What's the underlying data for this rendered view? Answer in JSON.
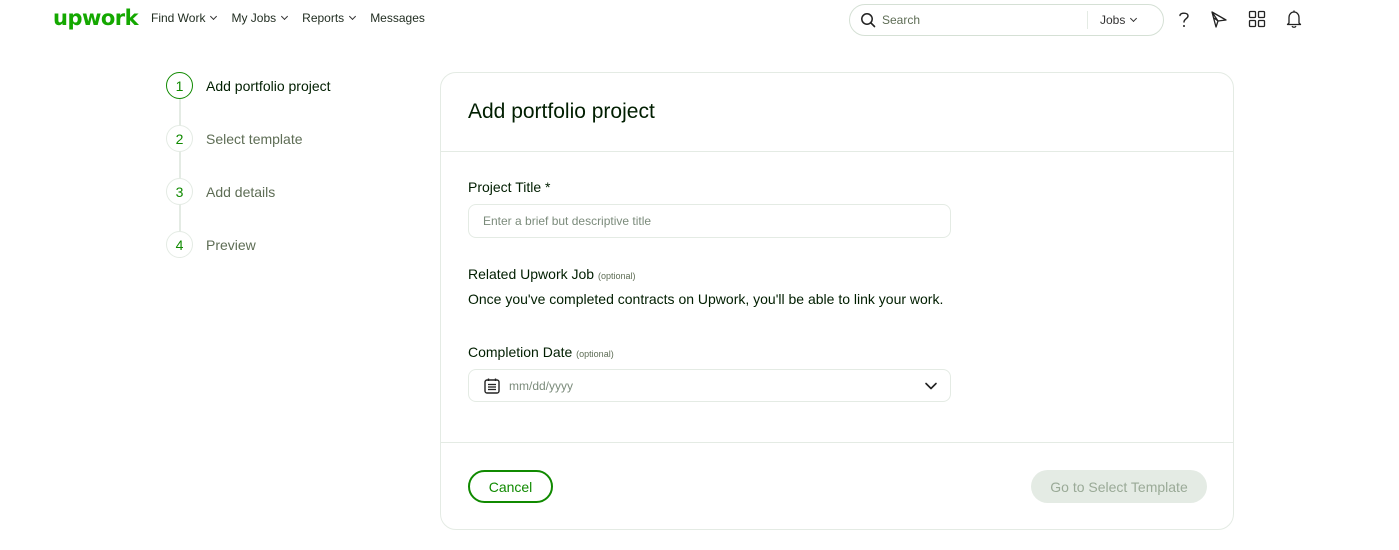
{
  "header": {
    "logo": "upwork",
    "nav": [
      {
        "label": "Find Work",
        "has_dropdown": true
      },
      {
        "label": "My Jobs",
        "has_dropdown": true
      },
      {
        "label": "Reports",
        "has_dropdown": true
      },
      {
        "label": "Messages",
        "has_dropdown": false
      }
    ],
    "search": {
      "placeholder": "Search",
      "value": "",
      "type_selected": "Jobs"
    },
    "icons": [
      "help-icon",
      "direct-contracts-icon",
      "apps-grid-icon",
      "notifications-bell-icon"
    ]
  },
  "steps": [
    {
      "number": "1",
      "label": "Add portfolio project",
      "active": true
    },
    {
      "number": "2",
      "label": "Select template",
      "active": false
    },
    {
      "number": "3",
      "label": "Add details",
      "active": false
    },
    {
      "number": "4",
      "label": "Preview",
      "active": false
    }
  ],
  "form": {
    "title": "Add portfolio project",
    "project_title": {
      "label": "Project Title *",
      "placeholder": "Enter a brief but descriptive title",
      "value": ""
    },
    "related_job": {
      "label": "Related Upwork Job",
      "optional": "(optional)",
      "helper": "Once you've completed contracts on Upwork, you'll be able to link your work."
    },
    "completion_date": {
      "label": "Completion Date",
      "optional": "(optional)",
      "placeholder": "mm/dd/yyyy"
    },
    "cancel_label": "Cancel",
    "next_label": "Go to Select Template"
  },
  "colors": {
    "brand": "#14a800",
    "accent": "#108a00",
    "disabled_bg": "#e4ebe4"
  }
}
